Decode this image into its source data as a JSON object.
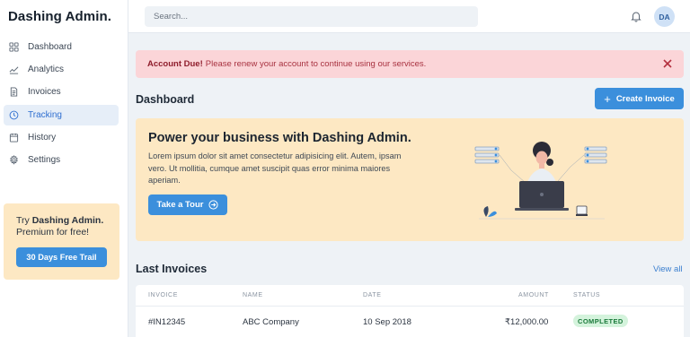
{
  "brand": {
    "name": "Dashing Admin."
  },
  "sidebar": {
    "items": [
      {
        "label": "Dashboard",
        "icon": "grid-icon",
        "active": false
      },
      {
        "label": "Analytics",
        "icon": "chart-line-icon",
        "active": false
      },
      {
        "label": "Invoices",
        "icon": "document-icon",
        "active": false
      },
      {
        "label": "Tracking",
        "icon": "clock-icon",
        "active": true
      },
      {
        "label": "History",
        "icon": "calendar-icon",
        "active": false
      },
      {
        "label": "Settings",
        "icon": "gear-icon",
        "active": false
      }
    ],
    "promo": {
      "prefix": "Try ",
      "brand": "Dashing Admin.",
      "suffix": "Premium for free!",
      "button": "30 Days Free Trail"
    }
  },
  "header": {
    "search_placeholder": "Search...",
    "avatar_initials": "DA"
  },
  "alert": {
    "title": "Account Due!",
    "message": "Please renew your account to continue using our services."
  },
  "main": {
    "title": "Dashboard",
    "create_button": "Create Invoice",
    "hero": {
      "title": "Power your business with Dashing Admin.",
      "description": "Lorem ipsum dolor sit amet consectetur adipisicing elit. Autem, ipsam vero. Ut mollitia, cumque amet suscipit quas error minima maiores aperiam.",
      "button": "Take a Tour"
    },
    "invoices": {
      "title": "Last Invoices",
      "view_all": "View all",
      "columns": [
        "INVOICE",
        "NAME",
        "DATE",
        "AMOUNT",
        "STATUS"
      ],
      "rows": [
        {
          "invoice": "#IN12345",
          "name": "ABC Company",
          "date": "10 Sep 2018",
          "amount": "₹12,000.00",
          "status": "COMPLETED"
        }
      ]
    }
  },
  "colors": {
    "accent": "#3b8fdc",
    "hero_bg": "#fde8c3",
    "alert_bg": "#fbd5d8",
    "success_bg": "#d4f3dc"
  }
}
